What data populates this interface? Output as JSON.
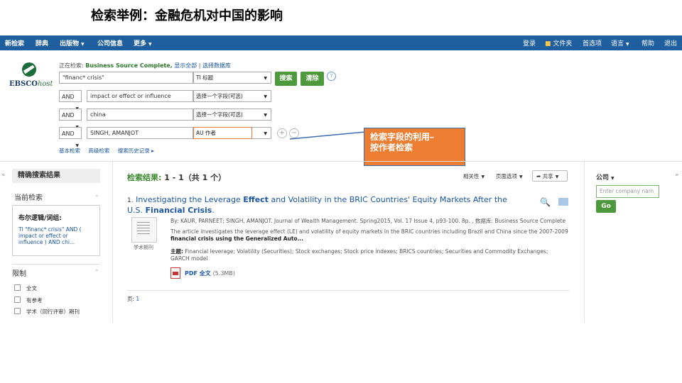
{
  "slide": {
    "title": "检索举例：金融危机对中国的影响"
  },
  "nav": {
    "left": [
      "新检索",
      "辞典",
      "出版物",
      "公司信息",
      "更多"
    ],
    "right": [
      "登录",
      "文件夹",
      "首选项",
      "语言",
      "帮助",
      "退出"
    ]
  },
  "logo": {
    "ebsco": "EBSCO",
    "host": "host"
  },
  "searching": {
    "label": "正在检索:",
    "db": "Business Source Complete,",
    "show_all": "显示全部",
    "choose_db": "选择数据库"
  },
  "search": {
    "rows": [
      {
        "op": "",
        "term": "\"financ* crisis\"",
        "field": "TI 标题"
      },
      {
        "op": "AND",
        "term": "impact or effect or influence",
        "field": "选择一个字段(可选)"
      },
      {
        "op": "AND",
        "term": "china",
        "field": "选择一个字段(可选)"
      },
      {
        "op": "AND",
        "term": "SINGH, AMANJOT",
        "field": "AU 作者"
      }
    ],
    "search_button": "搜索",
    "clear_button": "清除",
    "help": "?",
    "plus": "+",
    "minus": "−",
    "links": [
      "基本检索",
      "高级检索",
      "搜索历史记录 ▸"
    ]
  },
  "callout": {
    "line1": "检索字段的利用–",
    "line2": "按作者检索"
  },
  "left_panel": {
    "title": "精确搜索结果",
    "current_search": "当前检索",
    "bool_label": "布尔逻辑/词组:",
    "bool_query": "TI \"financ* crisis\" AND ( impact or effect or influence ) AND chi...",
    "limit": "限制",
    "limits": [
      "全文",
      "有参考",
      "学术（同行评审）期刊"
    ]
  },
  "results": {
    "label": "检索结果:",
    "range": "1 - 1（共 1 个）",
    "sort_relevance": "相关性",
    "page_options": "页面选项",
    "share": "共享",
    "item": {
      "num": "1.",
      "title_a": "Investigating the Leverage ",
      "title_b": "Effect",
      "title_c": " and Volatility in the BRIC Countries' Equity Markets After the U.S. ",
      "title_d": "Financial Crisis",
      "title_e": ".",
      "type_label": "学术期刊",
      "byline": "By: KAUR, PARNEET; SINGH, AMANJOT. Journal of Wealth Management. Spring2015, Vol. 17 Issue 4, p93-100. 8p. , 数据库: Business Source Complete",
      "abstract_1": "The article investigates the leverage effect (LE) and volatility of equity markets in the BRIC countries including Brazil and China since the 2007-2009",
      "abstract_2": "financial crisis using the Generalized Auto...",
      "subjects_label": "主题:",
      "subjects": "Financial leverage; Volatility (Securities); Stock exchanges; Stock price indexes; BRICS countries; Securities and Commodity Exchanges; GARCH model",
      "pdf_label": "PDF 全文",
      "pdf_size": "(5.3MB)"
    },
    "pager_label": "页:",
    "pager_page": "1"
  },
  "right_panel": {
    "title": "公司",
    "placeholder": "Enter company nam",
    "go": "Go"
  },
  "colors": {
    "nav_bg": "#1f5f9f",
    "green": "#4d9a3c",
    "callout": "#ed7d31",
    "link": "#1a56a8"
  }
}
